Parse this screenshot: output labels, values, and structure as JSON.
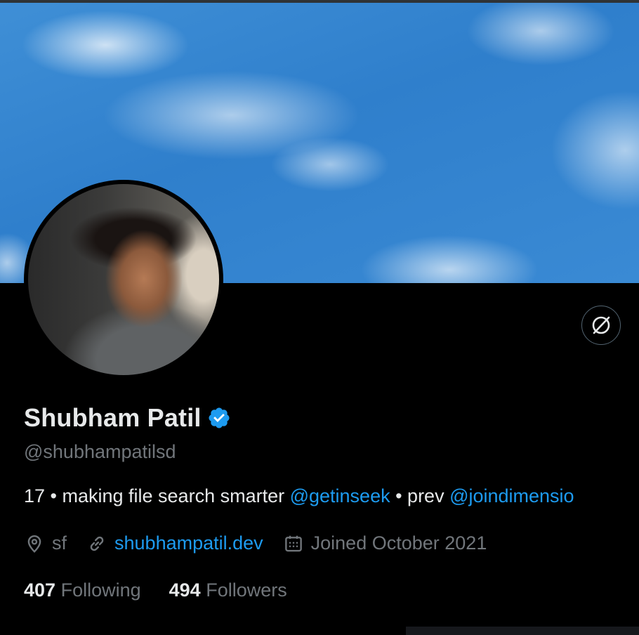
{
  "profile": {
    "name": "Shubham Patil",
    "handle": "@shubhampatilsd",
    "verified": true,
    "bio": {
      "prefix": "17 • making file search smarter ",
      "mention1": "@getinseek",
      "middle": " • prev ",
      "mention2": "@joindimensio"
    },
    "location": "sf",
    "website": "shubhampatil.dev",
    "joined": "Joined October 2021",
    "following_count": "407",
    "following_label": "Following",
    "followers_count": "494",
    "followers_label": "Followers"
  },
  "icons": {
    "action": "grok-icon",
    "location": "location-pin-icon",
    "website": "link-icon",
    "joined": "calendar-icon",
    "verified": "verified-badge-icon"
  },
  "colors": {
    "background": "#000000",
    "accent": "#1d9bf0",
    "text_primary": "#e7e9ea",
    "text_secondary": "#71767b"
  }
}
